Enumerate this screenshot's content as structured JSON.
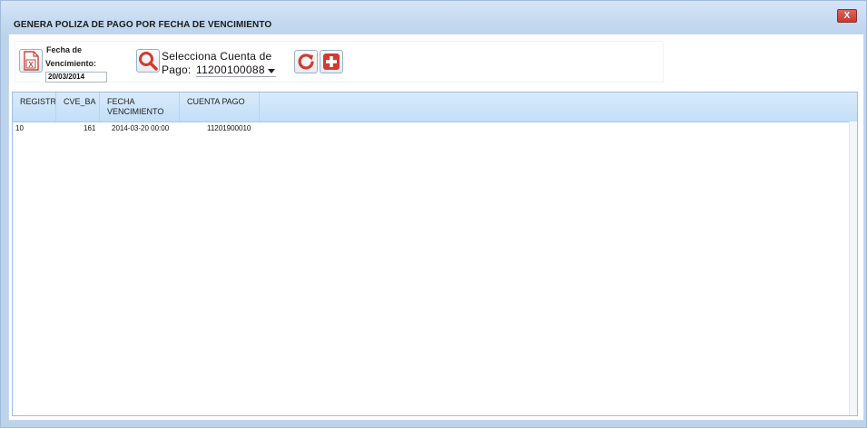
{
  "window": {
    "title": "GENERA POLIZA DE PAGO POR FECHA DE VENCIMIENTO",
    "close_label": "X"
  },
  "toolbar": {
    "excel_icon": "excel-export-icon",
    "fecha_label_line1": "Fecha de",
    "fecha_label_line2": "Vencimiento:",
    "fecha_value": "20/03/2014",
    "search_icon": "magnifier-icon",
    "cuenta_label_line1": "Selecciona Cuenta de",
    "cuenta_label_line2": "Pago:",
    "cuenta_value": "11200100088",
    "refresh_icon": "refresh-icon",
    "add_icon": "add-icon"
  },
  "grid": {
    "columns": [
      {
        "line1": "REGISTR",
        "line2": ""
      },
      {
        "line1": "CVE_BA",
        "line2": ""
      },
      {
        "line1": "FECHA",
        "line2": "VENCIMIENTO"
      },
      {
        "line1": "CUENTA PAGO",
        "line2": ""
      }
    ],
    "rows": [
      {
        "registro": "10",
        "cve_banco": "161",
        "fecha": "2014-03-20 00:00",
        "cuenta": "11201900010"
      }
    ]
  },
  "colors": {
    "frame": "#bcd3ec",
    "header_bg": "#c2def7",
    "close_button": "#c23b34",
    "icon_red": "#d23a2f"
  }
}
